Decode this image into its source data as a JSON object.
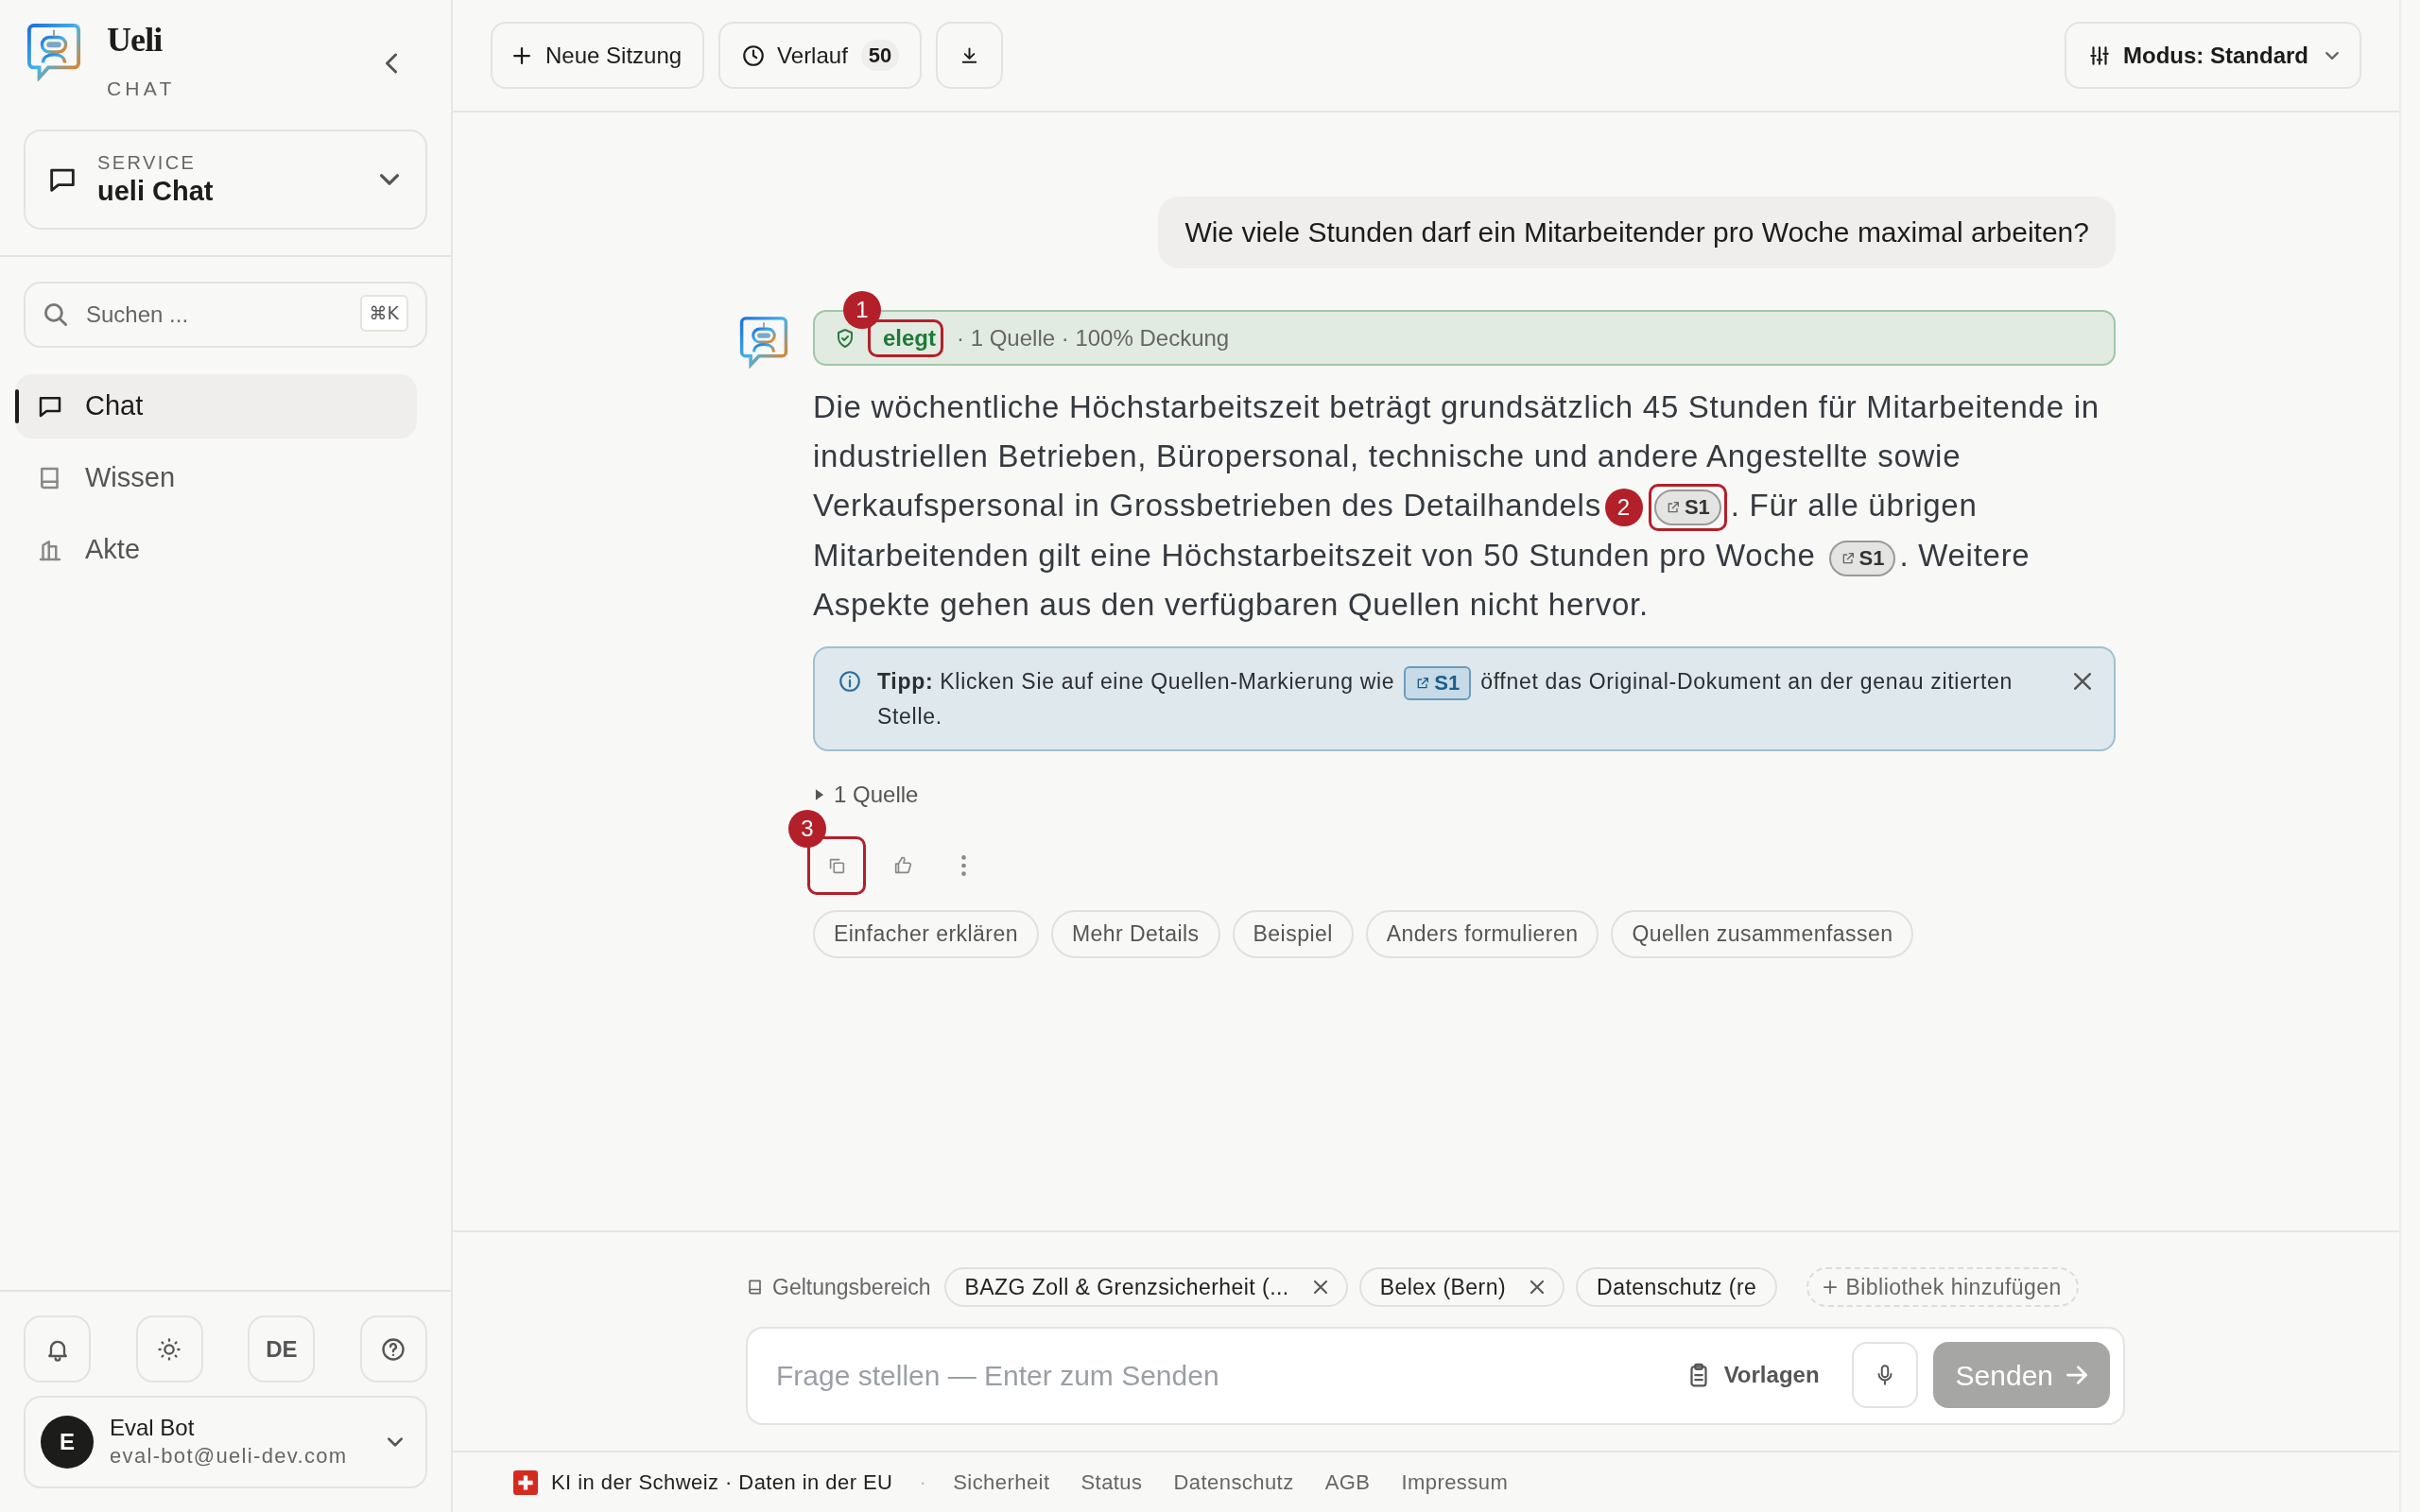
{
  "sidebar": {
    "brand": {
      "name": "Ueli",
      "subtitle": "CHAT"
    },
    "service": {
      "label": "SERVICE",
      "value": "ueli Chat"
    },
    "search": {
      "placeholder": "Suchen ...",
      "shortcut": "⌘K"
    },
    "nav": [
      {
        "label": "Chat",
        "selected": true
      },
      {
        "label": "Wissen",
        "selected": false
      },
      {
        "label": "Akte",
        "selected": false
      }
    ],
    "language": "DE",
    "user": {
      "initial": "E",
      "name": "Eval Bot",
      "email": "eval-bot@ueli-dev.com"
    }
  },
  "toolbar": {
    "new_session": "Neue Sitzung",
    "history": "Verlauf",
    "history_count": "50",
    "mode": "Modus: Standard"
  },
  "conversation": {
    "question": "Wie viele Stunden darf ein Mitarbeitender pro Woche maximal arbeiten?",
    "answer": {
      "status": {
        "label": "elegt",
        "detail": "· 1 Quelle · 100% Deckung",
        "marker": "1"
      },
      "segments": [
        {
          "kind": "text",
          "text": "Die wöchentliche Höchstarbeitszeit beträgt grundsätzlich 45 Stunden für Mitarbeitende in industriellen Betrieben, Büropersonal, technische und andere Angestellte sowie Verkaufspersonal in Grossbetrieben des Detailhandels"
        },
        {
          "kind": "cite",
          "label": "S1",
          "marker": "2"
        },
        {
          "kind": "text",
          "text": ". Für alle übrigen Mitarbeitenden gilt eine Höchstarbeitszeit von 50 Stunden pro Woche "
        },
        {
          "kind": "cite",
          "label": "S1"
        },
        {
          "kind": "text",
          "text": ". Weitere Aspekte gehen aus den verfügbaren Quellen nicht hervor."
        }
      ],
      "tip": {
        "before": "**Tipp:** Klicken Sie auf eine Quellen-Markierung wie",
        "chip": "S1",
        "after": "öffnet das Original-Dokument an der genau zitierten Stelle."
      },
      "sources": {
        "label": "1 Quelle",
        "expanded": false
      },
      "actions": [
        {
          "kind": "copy",
          "marker": "3"
        },
        {
          "kind": "like"
        },
        {
          "kind": "more"
        }
      ],
      "suggestions": [
        "Einfacher erklären",
        "Mehr Details",
        "Beispiel",
        "Anders formulieren",
        "Quellen zusammenfassen"
      ]
    }
  },
  "composer": {
    "scope_label": "Geltungsbereich",
    "scopes": [
      {
        "label": "BAZG Zoll & Grenzsicherheit (...",
        "removable": true
      },
      {
        "label": "Belex (Bern)",
        "removable": true
      },
      {
        "label": "Datenschutz (re",
        "removable": false
      }
    ],
    "add_library": "Bibliothek hinzufügen",
    "placeholder": "Frage stellen — Enter zum Senden",
    "templates": "Vorlagen",
    "send": "Senden",
    "send_disabled": true
  },
  "footer": {
    "region": "KI in der Schweiz · Daten in der EU",
    "separator": "·",
    "links": [
      "Sicherheit",
      "Status",
      "Datenschutz",
      "AGB",
      "Impressum"
    ]
  }
}
